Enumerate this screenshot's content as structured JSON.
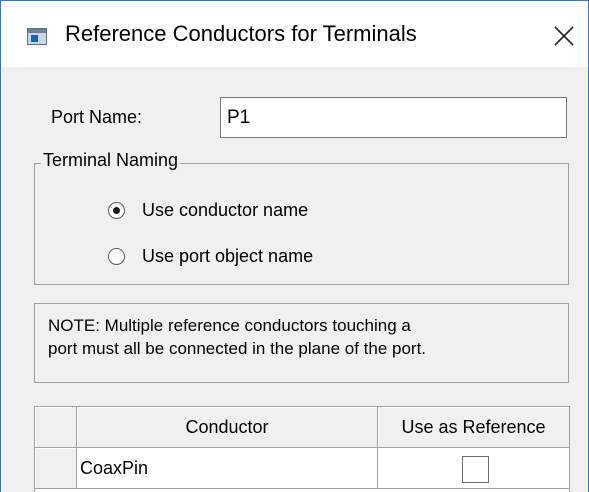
{
  "window": {
    "title": "Reference Conductors for Terminals",
    "icon": "app-window-icon",
    "close_icon": "close-icon"
  },
  "port": {
    "label": "Port Name:",
    "value": "P1"
  },
  "terminal_naming": {
    "legend": "Terminal Naming",
    "options": [
      {
        "label": "Use conductor name",
        "checked": true
      },
      {
        "label": "Use port object name",
        "checked": false
      }
    ]
  },
  "note": {
    "line1": "NOTE: Multiple reference conductors touching a",
    "line2": "port must all be connected in the plane of the port."
  },
  "grid": {
    "columns": [
      "Conductor",
      "Use as Reference"
    ],
    "rows": [
      {
        "conductor": "CoaxPin",
        "use_as_reference": false
      }
    ]
  }
}
